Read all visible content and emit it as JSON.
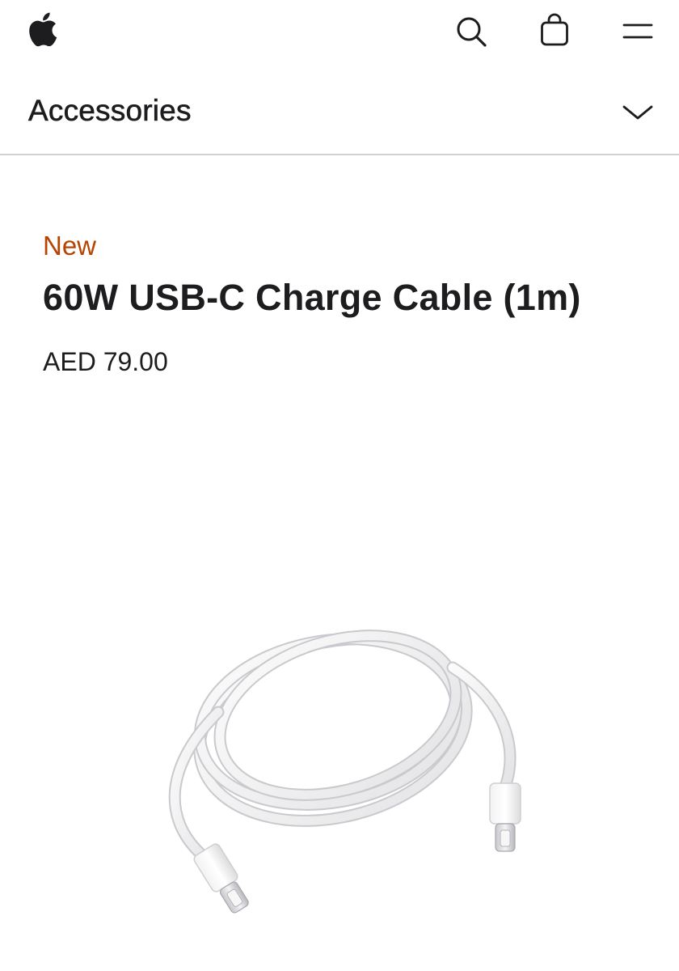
{
  "globalnav": {
    "icons": [
      "apple-logo-icon",
      "search-icon",
      "bag-icon",
      "menu-icon"
    ]
  },
  "localnav": {
    "title": "Accessories",
    "toggle_icon": "chevron-down-icon"
  },
  "product": {
    "badge": "New",
    "title": "60W USB-C Charge Cable (1m)",
    "price": "AED 79.00"
  },
  "colors": {
    "text": "#1d1d1f",
    "badge": "#b64400",
    "divider": "#d2d2d7",
    "background": "#ffffff"
  }
}
